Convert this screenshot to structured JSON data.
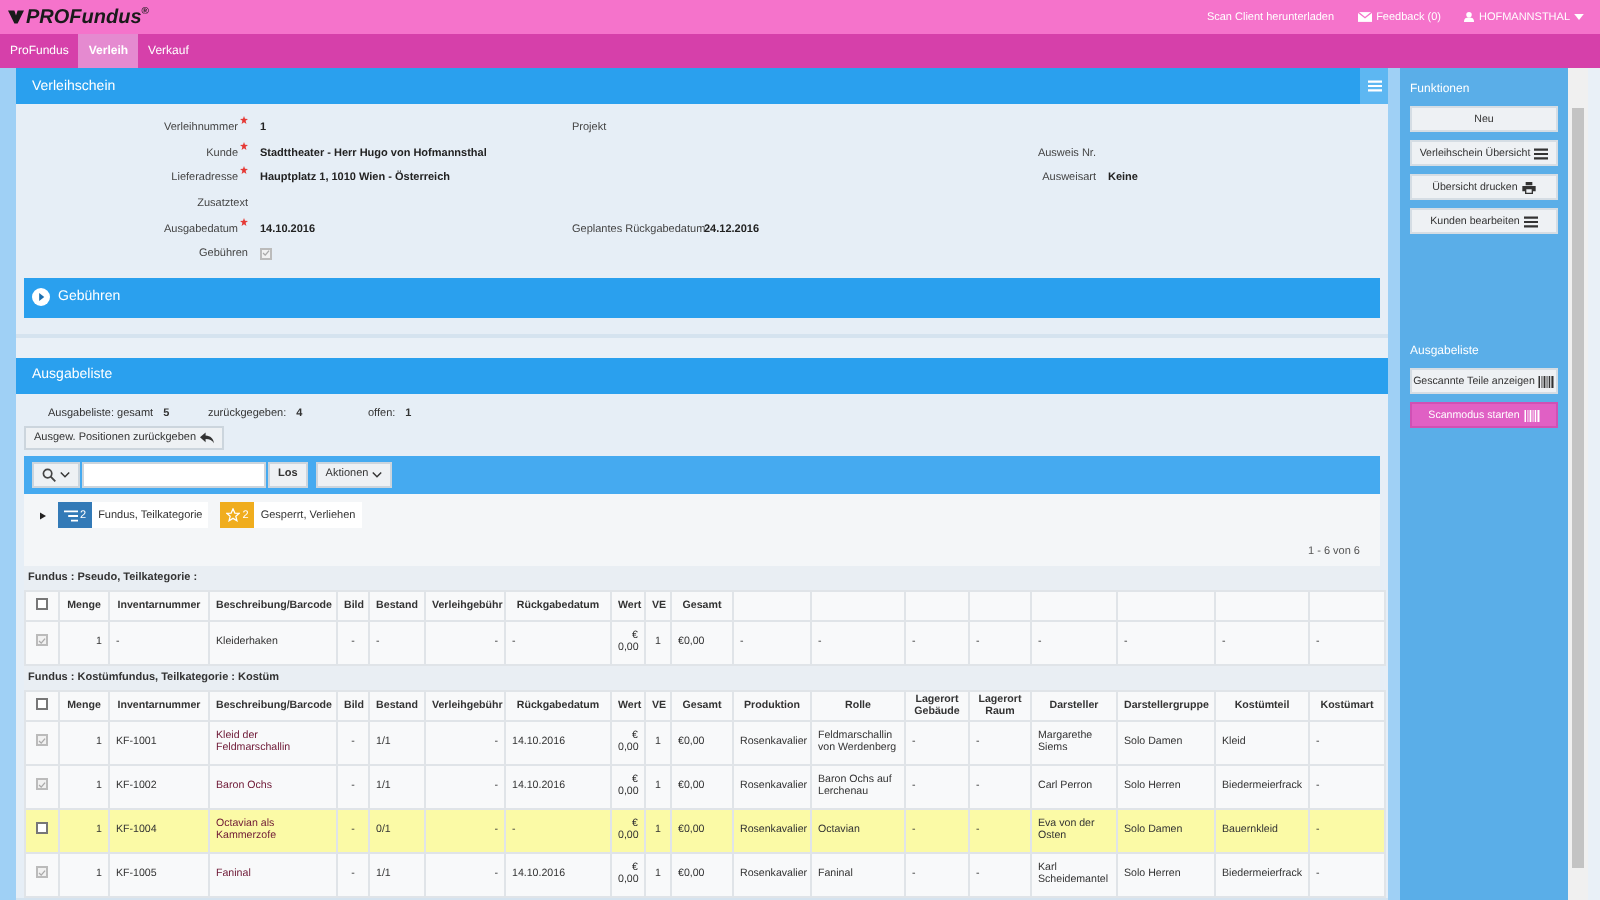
{
  "topbar": {
    "logo": "PROFundus",
    "logo_mark": "®",
    "links": [
      {
        "kind": "text",
        "label": "Scan Client herunterladen"
      },
      {
        "kind": "mail",
        "label": "Feedback (0)"
      },
      {
        "kind": "user",
        "label": "HOFMANNSTHAL"
      }
    ]
  },
  "nav": [
    {
      "label": "ProFundus",
      "selected": false
    },
    {
      "label": "Verleih",
      "selected": true
    },
    {
      "label": "Verkauf",
      "selected": false
    }
  ],
  "voucher": {
    "title": "Verleihschein",
    "rows": [
      {
        "left": {
          "label": "Verleihnummer",
          "required": true,
          "value": "1"
        },
        "middle": {
          "label": "Projekt"
        }
      },
      {
        "left": {
          "label": "Kunde",
          "required": true,
          "value": "Stadttheater - Herr Hugo von Hofmannsthal"
        },
        "right": {
          "label": "Ausweis Nr."
        }
      },
      {
        "left": {
          "label": "Lieferadresse",
          "required": true,
          "value": "Hauptplatz 1, 1010 Wien - Österreich"
        },
        "right": {
          "label": "Ausweisart",
          "value": "Keine"
        }
      },
      {
        "left": {
          "label": "Zusatztext",
          "required": false
        }
      },
      {
        "left": {
          "label": "Ausgabedatum",
          "required": true,
          "value": "14.10.2016"
        },
        "middle": {
          "label": "Geplantes Rückgabedatum",
          "value": "24.12.2016"
        }
      },
      {
        "left": {
          "label": "Gebühren",
          "required": false,
          "kind": "checkbox",
          "checked": true,
          "disabled": true
        }
      }
    ],
    "fees_panel": {
      "label": "Gebühren",
      "expanded": false
    }
  },
  "issue_list": {
    "title": "Ausgabeliste",
    "stats": [
      {
        "label": "Ausgabeliste: gesamt",
        "value": "5"
      },
      {
        "label": "zurückgegeben:",
        "value": "4"
      },
      {
        "label": "offen:",
        "value": "1"
      }
    ],
    "return_button": "Ausgew. Positionen zurückgeben",
    "go_button": "Los",
    "actions_button": "Aktionen",
    "filters": [
      {
        "kind": "category",
        "count": "2",
        "label": "Fundus, Teilkategorie",
        "color": "#337ab7"
      },
      {
        "kind": "status",
        "count": "2",
        "label": "Gesperrt, Verliehen",
        "color": "#f0ad1e"
      }
    ],
    "pagination": "1 - 6 von 6",
    "groups": [
      {
        "title": "Fundus : Pseudo, Teilkategorie :",
        "links": false,
        "select_all": {
          "checked": false,
          "disabled": false
        },
        "columns": [
          "Menge",
          "Inventarnummer",
          "Beschreibung/Barcode",
          "Bild",
          "Bestand",
          "Verleihgebühr",
          "Rückgabedatum",
          "Wert",
          "VE",
          "Gesamt"
        ],
        "rows": [
          {
            "checked": true,
            "disabled": true,
            "highlighted": false,
            "cells": [
              "1",
              "-",
              "Kleiderhaken",
              "-",
              "-",
              "-",
              "-",
              "€ 0,00",
              "1",
              "€0,00",
              "-",
              "-",
              "-",
              "-",
              "-",
              "-",
              "-",
              "-"
            ]
          }
        ]
      },
      {
        "title": "Fundus : Kostümfundus, Teilkategorie : Kostüm",
        "links": true,
        "select_all": {
          "checked": false,
          "disabled": false
        },
        "columns": [
          "Menge",
          "Inventarnummer",
          "Beschreibung/Barcode",
          "Bild",
          "Bestand",
          "Verleihgebühr",
          "Rückgabedatum",
          "Wert",
          "VE",
          "Gesamt",
          "Produktion",
          "Rolle",
          "Lagerort Gebäude",
          "Lagerort Raum",
          "Darsteller",
          "Darstellergruppe",
          "Kostümteil",
          "Kostümart"
        ],
        "rows": [
          {
            "checked": true,
            "disabled": true,
            "highlighted": false,
            "cells": [
              "1",
              "KF-1001",
              "Kleid der Feldmarschallin",
              "-",
              "1/1",
              "-",
              "14.10.2016",
              "€ 0,00",
              "1",
              "€0,00",
              "Rosenkavalier",
              "Feldmarschallin von Werdenberg",
              "-",
              "-",
              "Margarethe Siems",
              "Solo Damen",
              "Kleid",
              "-"
            ]
          },
          {
            "checked": true,
            "disabled": true,
            "highlighted": false,
            "cells": [
              "1",
              "KF-1002",
              "Baron Ochs",
              "-",
              "1/1",
              "-",
              "14.10.2016",
              "€ 0,00",
              "1",
              "€0,00",
              "Rosenkavalier",
              "Baron Ochs auf Lerchenau",
              "-",
              "-",
              "Carl Perron",
              "Solo Herren",
              "Biedermeierfrack",
              "-"
            ]
          },
          {
            "checked": false,
            "disabled": false,
            "highlighted": true,
            "cells": [
              "1",
              "KF-1004",
              "Octavian als Kammerzofe",
              "-",
              "0/1",
              "-",
              "-",
              "€ 0,00",
              "1",
              "€0,00",
              "Rosenkavalier",
              "Octavian",
              "-",
              "-",
              "Eva von der Osten",
              "Solo Damen",
              "Bauernkleid",
              "-"
            ]
          },
          {
            "checked": true,
            "disabled": true,
            "highlighted": false,
            "cells": [
              "1",
              "KF-1005",
              "Faninal",
              "-",
              "1/1",
              "-",
              "14.10.2016",
              "€ 0,00",
              "1",
              "€0,00",
              "Rosenkavalier",
              "Faninal",
              "-",
              "-",
              "Karl Scheidemantel",
              "Solo Herren",
              "Biedermeierfrack",
              "-"
            ]
          }
        ]
      }
    ]
  },
  "sidebar": {
    "sections": [
      {
        "title": "Funktionen",
        "buttons": [
          {
            "label": "Neu",
            "kind": "plain",
            "primary": false
          },
          {
            "label": "Verleihschein Übersicht",
            "kind": "list",
            "primary": false
          },
          {
            "label": "Übersicht drucken",
            "kind": "print",
            "primary": false
          },
          {
            "label": "Kunden bearbeiten",
            "kind": "list",
            "primary": false
          }
        ]
      },
      {
        "title": "Ausgabeliste",
        "buttons": [
          {
            "label": "Gescannte Teile anzeigen",
            "kind": "scan",
            "primary": false
          },
          {
            "label": "Scanmodus starten",
            "kind": "scan",
            "primary": true
          }
        ]
      }
    ]
  }
}
